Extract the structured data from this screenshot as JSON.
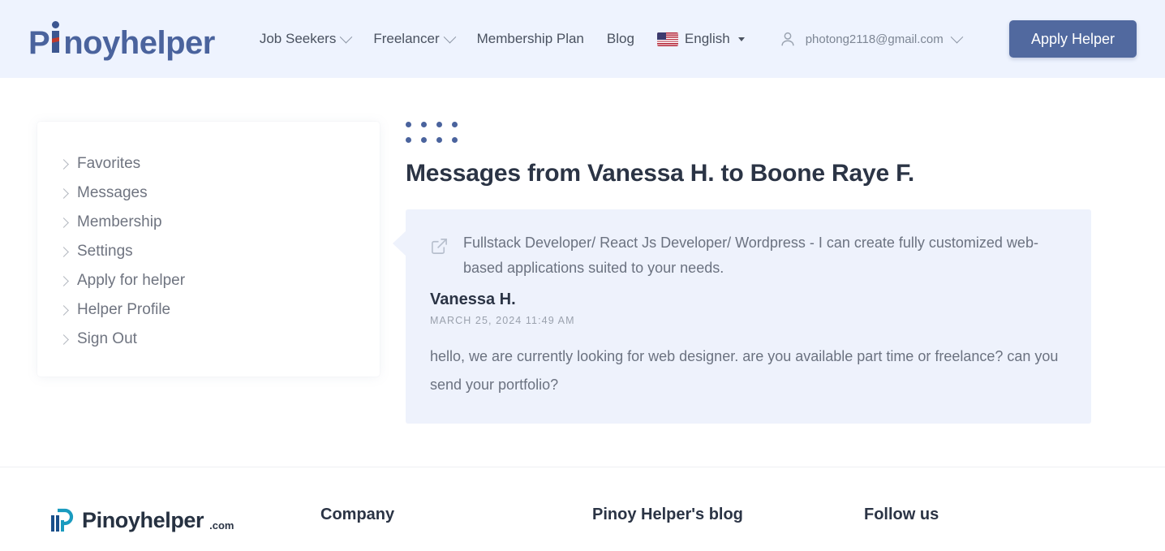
{
  "header": {
    "logo": {
      "p": "P",
      "rest": "noyhelper",
      "alt": "Pinoyhelper"
    },
    "nav": [
      {
        "label": "Job Seekers",
        "has_caret": true
      },
      {
        "label": "Freelancer",
        "has_caret": true
      },
      {
        "label": "Membership Plan",
        "has_caret": false
      },
      {
        "label": "Blog",
        "has_caret": false
      }
    ],
    "language": {
      "label": "English",
      "flag": "us-flag-icon"
    },
    "account": {
      "email": "photong2118@gmail.com",
      "icon": "person-icon"
    },
    "apply_button": "Apply Helper",
    "bg_color": "#eef3fe",
    "accent_color": "#51699f"
  },
  "sidebar": {
    "items": [
      {
        "label": "Favorites"
      },
      {
        "label": "Messages"
      },
      {
        "label": "Membership"
      },
      {
        "label": "Settings"
      },
      {
        "label": "Apply for helper"
      },
      {
        "label": "Helper Profile"
      },
      {
        "label": "Sign Out"
      }
    ]
  },
  "messages": {
    "title": "Messages from Vanessa H. to Boone Raye F.",
    "card": {
      "subject": "Fullstack Developer/ React Js Developer/ Wordpress - I can create fully customized web-based applications suited to your needs.",
      "sender": "Vanessa H.",
      "date": "MARCH 25, 2024 11:49 AM",
      "body": "hello, we are currently looking for web designer. are you available part time or freelance? can you send your portfolio?",
      "bg_color": "#eef2fc"
    }
  },
  "footer": {
    "logo_text": "Pinoyhelper",
    "logo_suffix": ".com",
    "columns": [
      {
        "heading": "Company"
      },
      {
        "heading": "Pinoy Helper's blog"
      },
      {
        "heading": "Follow us"
      }
    ]
  }
}
